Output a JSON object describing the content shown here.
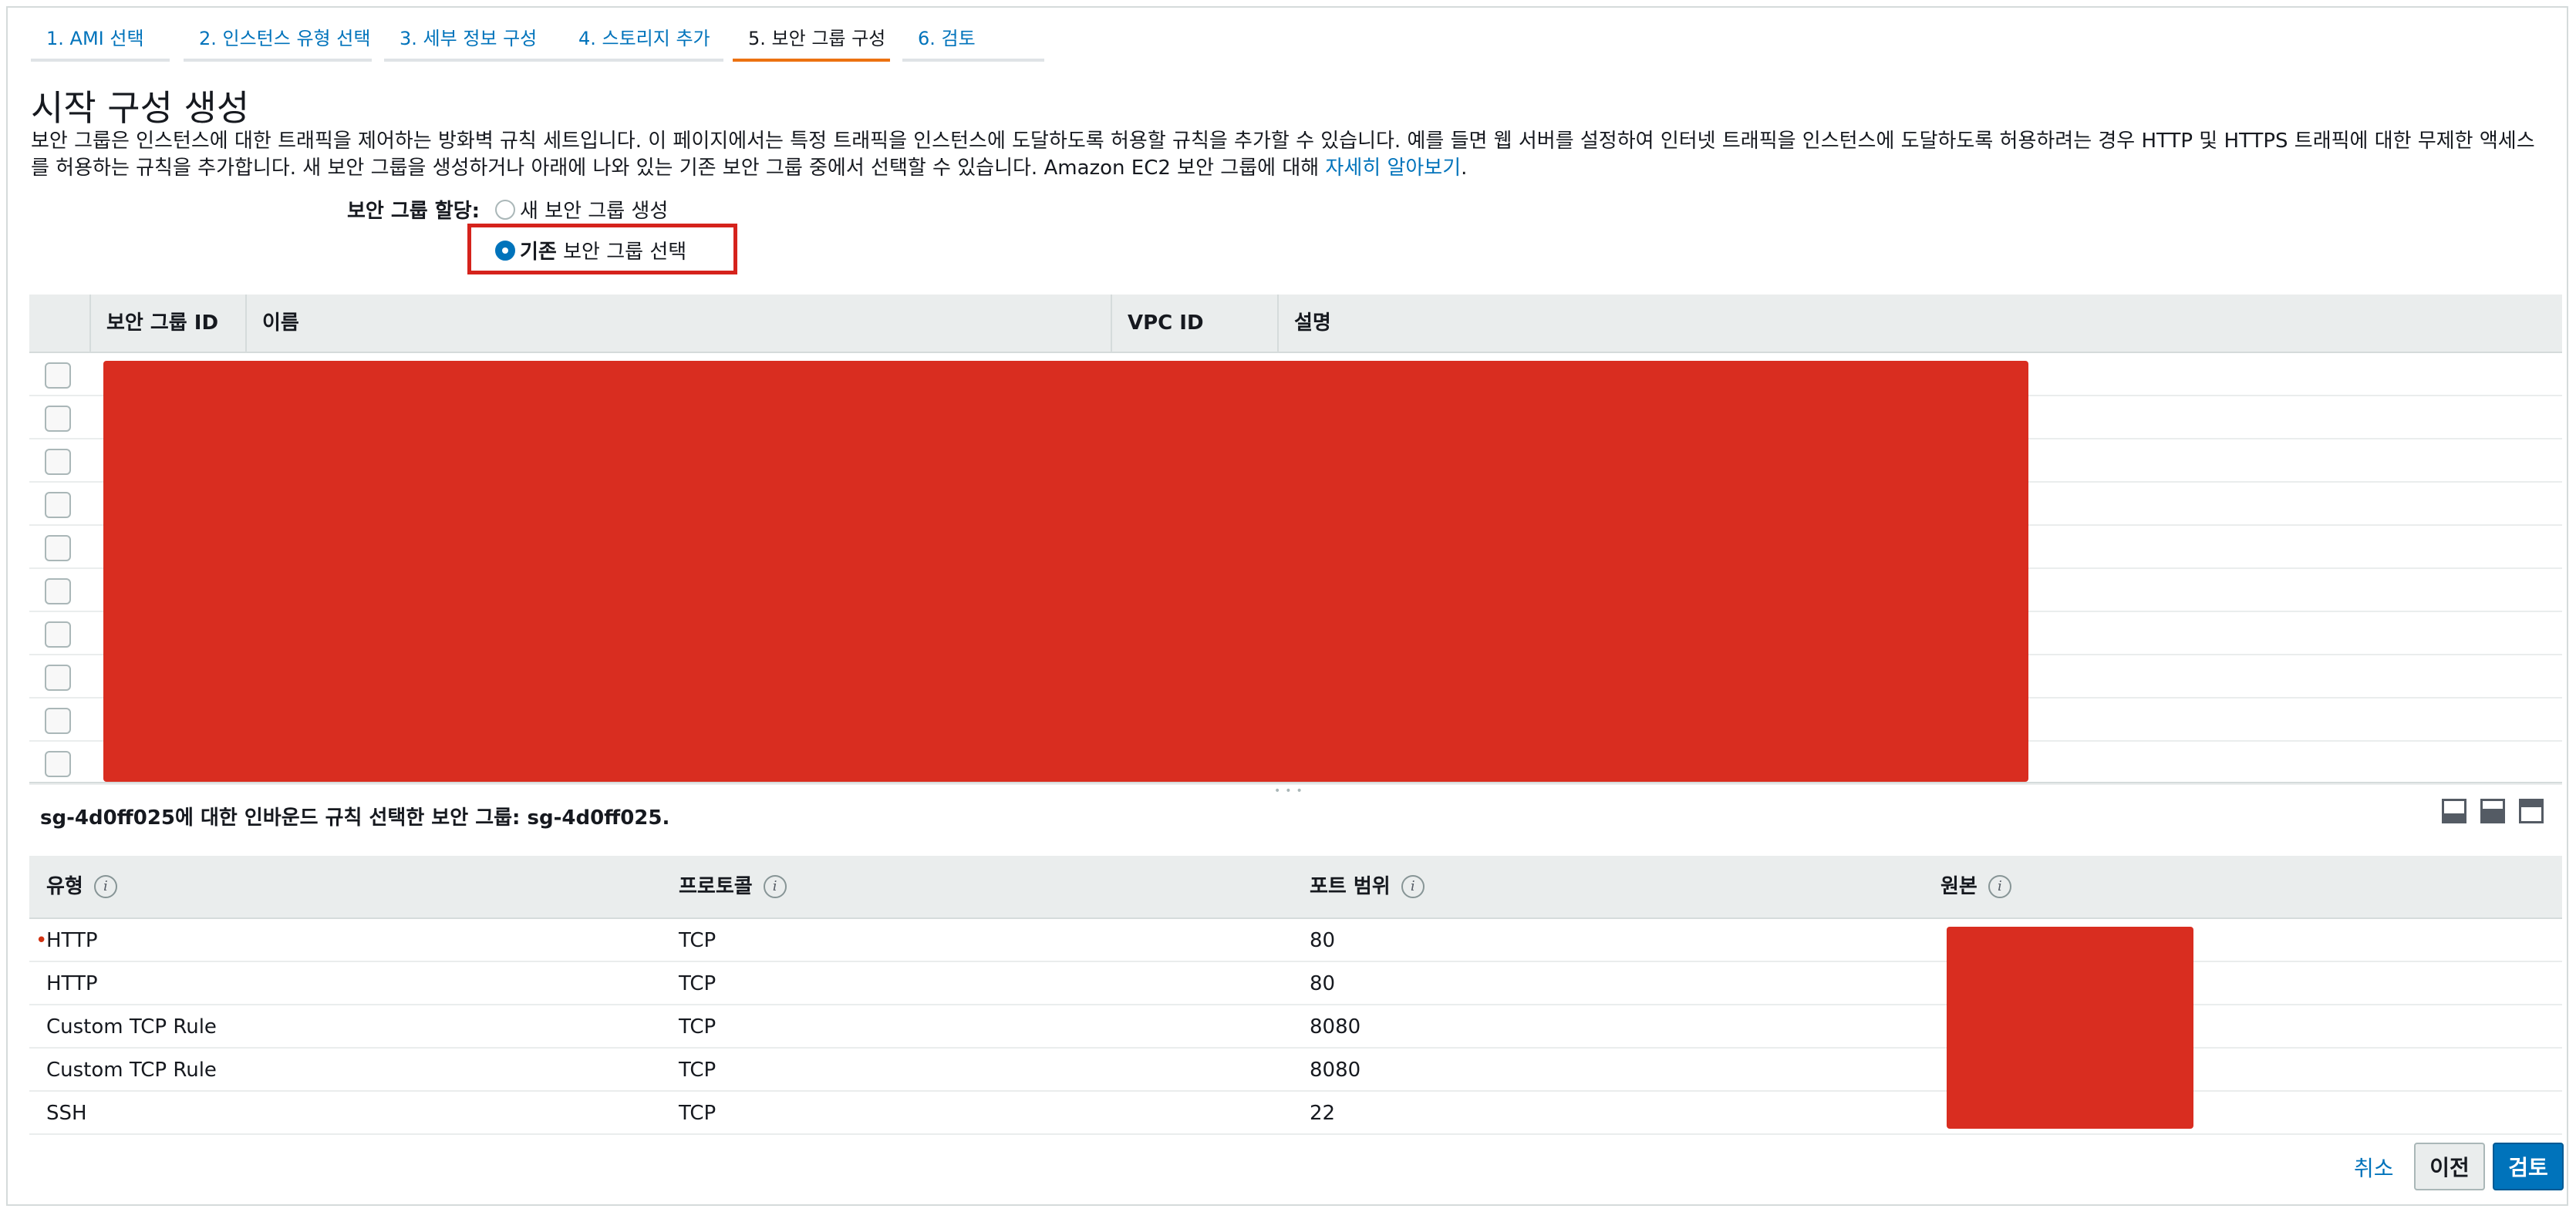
{
  "wizard": {
    "tabs": [
      {
        "label": "1. AMI 선택"
      },
      {
        "label": "2. 인스턴스 유형 선택"
      },
      {
        "label": "3. 세부 정보 구성"
      },
      {
        "label": "4. 스토리지 추가"
      },
      {
        "label": "5. 보안 그룹 구성"
      },
      {
        "label": "6. 검토"
      }
    ],
    "active_tab_index": 4
  },
  "page": {
    "title": "시작 구성 생성",
    "description_line1": "보안 그룹은 인스턴스에 대한 트래픽을 제어하는 방화벽 규칙 세트입니다. 이 페이지에서는 특정 트래픽을 인스턴스에 도달하도록 허용할 규칙을 추가할 수 있습니다. 예를 들면 웹 서버를 설정하여 인터넷 트래픽을 인스턴스에 도달하도록 허용하려는 경우 HTTP 및 HTTPS 트래픽에 대한 무제한 액세스",
    "description_line2": "를 허용하는 규칙을 추가합니다. 새 보안 그룹을 생성하거나 아래에 나와 있는 기존 보안 그룹 중에서 선택할 수 있습니다. Amazon EC2 보안 그룹에 대해 ",
    "learn_more": "자세히 알아보기",
    "description_end": "."
  },
  "assignment": {
    "label": "보안 그룹 할당:",
    "option_new": "새 보안 그룹 생성",
    "option_existing_bold": "기존",
    "option_existing_rest": " 보안 그룹 선택",
    "selected": "existing"
  },
  "sg_table": {
    "headers": {
      "id": "보안 그룹 ID",
      "name": "이름",
      "vpc": "VPC ID",
      "desc": "설명"
    },
    "row_count": 10,
    "redacted": true
  },
  "inbound": {
    "title": "sg-4d0ff025에 대한 인바운드 규칙 선택한 보안 그룹: sg-4d0ff025."
  },
  "rules_table": {
    "headers": {
      "type": "유형",
      "protocol": "프로토콜",
      "port": "포트 범위",
      "source": "원본"
    },
    "rows": [
      {
        "type": "HTTP",
        "protocol": "TCP",
        "port": "80",
        "required": true
      },
      {
        "type": "HTTP",
        "protocol": "TCP",
        "port": "80",
        "required": false
      },
      {
        "type": "Custom TCP Rule",
        "protocol": "TCP",
        "port": "8080",
        "required": false
      },
      {
        "type": "Custom TCP Rule",
        "protocol": "TCP",
        "port": "8080",
        "required": false
      },
      {
        "type": "SSH",
        "protocol": "TCP",
        "port": "22",
        "required": false
      }
    ]
  },
  "footer": {
    "cancel": "취소",
    "previous": "이전",
    "review": "검토"
  },
  "colors": {
    "accent": "#0073bb",
    "active_tab": "#ec7211",
    "redaction": "#d92d20",
    "highlight": "#d5231c"
  }
}
